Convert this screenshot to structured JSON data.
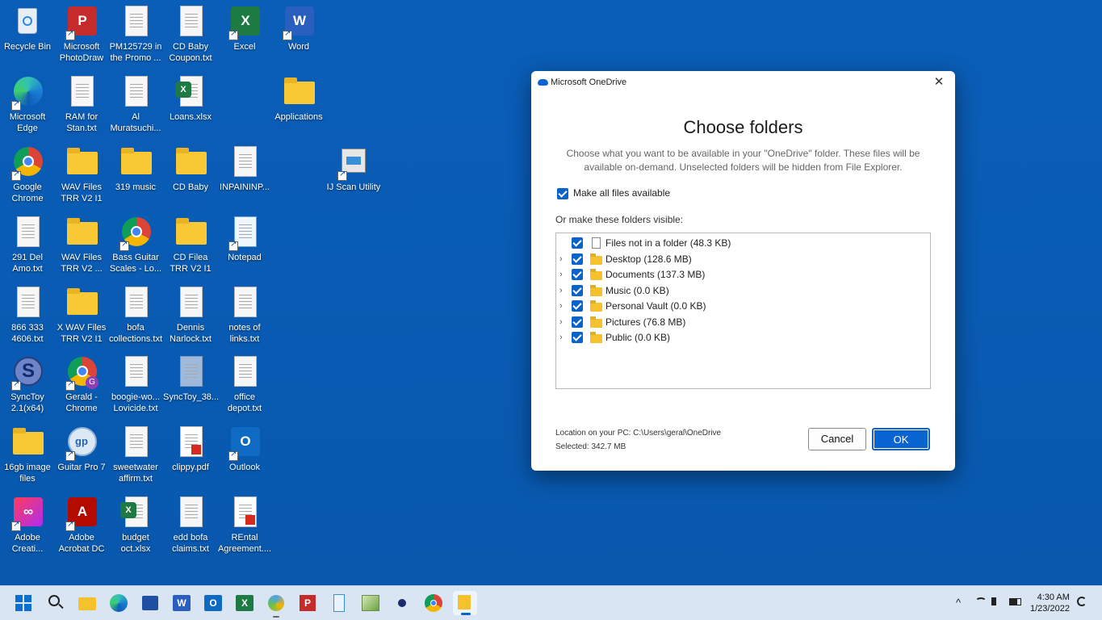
{
  "desktop": {
    "icons": [
      {
        "label": "Recycle Bin"
      },
      {
        "label": "Microsoft PhotoDraw"
      },
      {
        "label": "PM125729 in the Promo ..."
      },
      {
        "label": "CD Baby Coupon.txt"
      },
      {
        "label": "Excel"
      },
      {
        "label": "Word"
      },
      {
        "label": "Microsoft Edge"
      },
      {
        "label": "RAM for Stan.txt"
      },
      {
        "label": "Al Muratsuchi..."
      },
      {
        "label": "Loans.xlsx"
      },
      {
        "label": "Applications"
      },
      {
        "label": "Google Chrome"
      },
      {
        "label": "WAV Files TRR V2 I1"
      },
      {
        "label": "319 music"
      },
      {
        "label": "CD Baby"
      },
      {
        "label": "INPAININP..."
      },
      {
        "label": "IJ Scan Utility"
      },
      {
        "label": "291 Del Amo.txt"
      },
      {
        "label": "WAV Files TRR V2 ..."
      },
      {
        "label": "Bass Guitar Scales - Lo..."
      },
      {
        "label": "CD Filea TRR V2 I1"
      },
      {
        "label": "Notepad"
      },
      {
        "label": "866 333 4606.txt"
      },
      {
        "label": "X WAV Files TRR V2 I1"
      },
      {
        "label": "bofa collections.txt"
      },
      {
        "label": "Dennis Narlock.txt"
      },
      {
        "label": "notes of links.txt"
      },
      {
        "label": "SyncToy 2.1(x64)"
      },
      {
        "label": "Gerald - Chrome"
      },
      {
        "label": "boogie-wo... Lovicide.txt"
      },
      {
        "label": "SyncToy_38..."
      },
      {
        "label": "office depot.txt"
      },
      {
        "label": "16gb image files"
      },
      {
        "label": "Guitar Pro 7"
      },
      {
        "label": "sweetwater affirm.txt"
      },
      {
        "label": "clippy.pdf"
      },
      {
        "label": "Outlook"
      },
      {
        "label": "Adobe Creati..."
      },
      {
        "label": "Adobe Acrobat DC"
      },
      {
        "label": "budget oct.xlsx"
      },
      {
        "label": "edd bofa claims.txt"
      },
      {
        "label": "REntal Agreement...."
      }
    ]
  },
  "dialog": {
    "window_title": "Microsoft OneDrive",
    "heading": "Choose folders",
    "description": "Choose what you want to be available in your \"OneDrive\" folder. These files will be available on-demand. Unselected folders will be hidden from File Explorer.",
    "make_all_label": "Make all files available",
    "or_label": "Or make these folders visible:",
    "folders": [
      {
        "label": "Files not in a folder  (48.3 KB)"
      },
      {
        "label": "Desktop  (128.6 MB)"
      },
      {
        "label": "Documents  (137.3 MB)"
      },
      {
        "label": "Music  (0.0 KB)"
      },
      {
        "label": "Personal Vault  (0.0 KB)"
      },
      {
        "label": "Pictures  (76.8 MB)"
      },
      {
        "label": "Public  (0.0 KB)"
      }
    ],
    "location": "Location on your PC: C:\\Users\\geral\\OneDrive",
    "selected": "Selected: 342.7 MB",
    "cancel_label": "Cancel",
    "ok_label": "OK"
  },
  "taskbar": {
    "time": "4:30 AM",
    "date": "1/23/2022",
    "tray_chevron": "^"
  },
  "colors": {
    "desktop_bg": "#0a5cb4",
    "accent": "#0a64d2"
  }
}
